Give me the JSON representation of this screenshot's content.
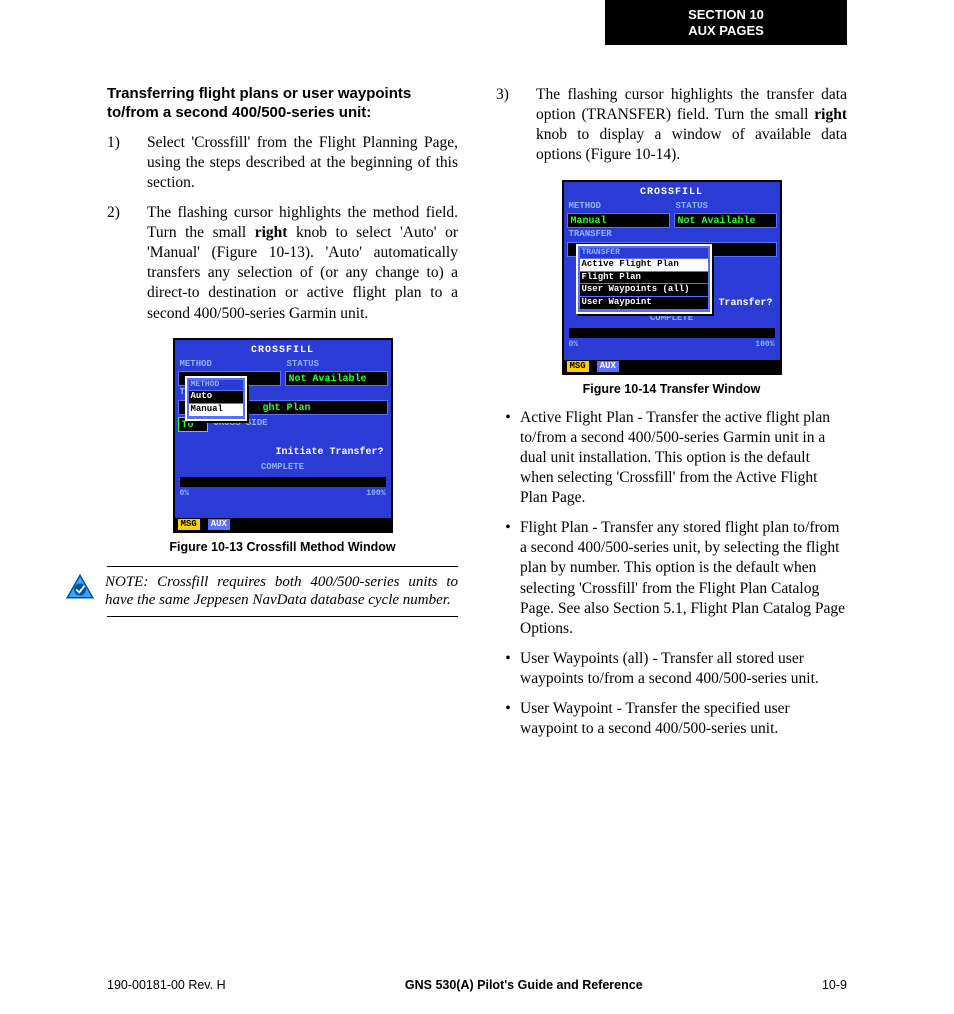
{
  "header": {
    "section_line1": "SECTION 10",
    "section_line2": "AUX PAGES"
  },
  "left": {
    "subhead": "Transferring flight plans or user waypoints to/from a second 400/500-series unit:",
    "steps": [
      {
        "n": "1)",
        "text": "Select 'Crossfill' from the Flight Planning Page, using the steps described at the beginning of this section."
      },
      {
        "n": "2)",
        "pre": "The flashing cursor highlights the method field. Turn the small ",
        "bold": "right",
        "post": " knob to select 'Auto' or 'Manual' (Figure 10-13).  'Auto' automatically transfers any selection of (or any change to) a direct-to destination or active flight plan to a second 400/500-series Garmin unit."
      }
    ],
    "fig13": {
      "caption": "Figure 10-13  Crossfill Method Window",
      "screen": {
        "title": "CROSSFILL",
        "labels": {
          "method": "METHOD",
          "status": "STATUS",
          "transfer": "TRANSFER",
          "cross_side": "CROSS-SIDE",
          "complete": "COMPLETE"
        },
        "status_value": "Not Available",
        "popup_title": "METHOD",
        "popup": [
          "Auto",
          "Manual"
        ],
        "fp_text": "ght Plan",
        "to": "To",
        "prompt": "Initiate Transfer?",
        "scale": {
          "low": "0%",
          "high": "100%"
        },
        "footer": {
          "msg": "MSG",
          "aux": "AUX"
        }
      }
    },
    "note": "NOTE:  Crossfill requires both 400/500-series units to have the same Jeppesen NavData database cycle number."
  },
  "right": {
    "step3": {
      "n": "3)",
      "pre": "The flashing cursor highlights the transfer data option (TRANSFER) field.  Turn the small ",
      "bold": "right",
      "post": " knob to display a window of available data options (Figure 10-14)."
    },
    "fig14": {
      "caption": "Figure 10-14  Transfer Window",
      "screen": {
        "title": "CROSSFILL",
        "labels": {
          "method": "METHOD",
          "status": "STATUS",
          "transfer": "TRANSFER",
          "complete": "COMPLETE"
        },
        "method_value": "Manual",
        "status_value": "Not Available",
        "popup_title": "TRANSFER",
        "popup": [
          "Active Flight Plan",
          "Flight Plan",
          "User Waypoints (all)",
          "User Waypoint"
        ],
        "prompt": "e Transfer?",
        "scale": {
          "low": "0%",
          "high": "100%"
        },
        "footer": {
          "msg": "MSG",
          "aux": "AUX"
        }
      }
    },
    "bullets": [
      "Active Flight Plan - Transfer the active flight plan to/from a second 400/500-series Garmin unit in a dual unit installation.  This option is the default when selecting 'Crossfill' from the Active Flight Plan Page.",
      "Flight Plan - Transfer any stored flight plan to/from a second 400/500-series unit, by selecting the flight plan by number.  This option is the default when selecting 'Crossfill' from the Flight Plan Catalog Page.  See also Section 5.1, Flight Plan Catalog Page Options.",
      "User Waypoints (all) - Transfer all stored user waypoints to/from a second 400/500-series unit.",
      "User Waypoint - Transfer the specified user waypoint to a second 400/500-series unit."
    ]
  },
  "footer": {
    "left": "190-00181-00  Rev. H",
    "center": "GNS 530(A) Pilot's Guide and Reference",
    "right": "10-9"
  }
}
